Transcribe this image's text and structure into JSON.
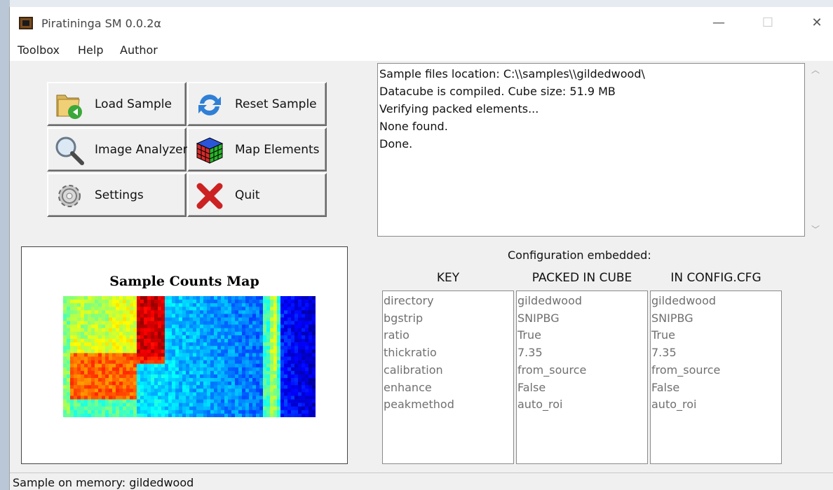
{
  "window": {
    "title": "Piratininga SM 0.0.2α",
    "minimize": "—",
    "maximize": "☐",
    "close": "✕"
  },
  "menu": {
    "items": [
      "Toolbox",
      "Help",
      "Author"
    ]
  },
  "toolbox": {
    "load_sample": "Load Sample",
    "reset_sample": "Reset Sample",
    "image_analyzer": "Image Analyzer",
    "map_elements": "Map Elements",
    "settings": "Settings",
    "quit": "Quit"
  },
  "log": {
    "lines": [
      "Sample files location: C:\\\\samples\\\\gildedwood\\",
      "Datacube is compiled. Cube size: 51.9 MB",
      "Verifying packed elements...",
      "None found.",
      "Done."
    ]
  },
  "plot": {
    "title": "Sample Counts Map"
  },
  "config": {
    "title": "Configuration embedded:",
    "headers": [
      "KEY",
      "PACKED IN CUBE",
      "IN CONFIG.CFG"
    ],
    "keys": [
      "directory",
      "bgstrip",
      "ratio",
      "thickratio",
      "calibration",
      "enhance",
      "peakmethod"
    ],
    "packed": [
      "gildedwood",
      "SNIPBG",
      "True",
      "7.35",
      "from_source",
      "False",
      "auto_roi"
    ],
    "config_cfg": [
      "gildedwood",
      "SNIPBG",
      "True",
      "7.35",
      "from_source",
      "False",
      "auto_roi"
    ]
  },
  "status": {
    "text": "Sample on memory: gildedwood"
  }
}
